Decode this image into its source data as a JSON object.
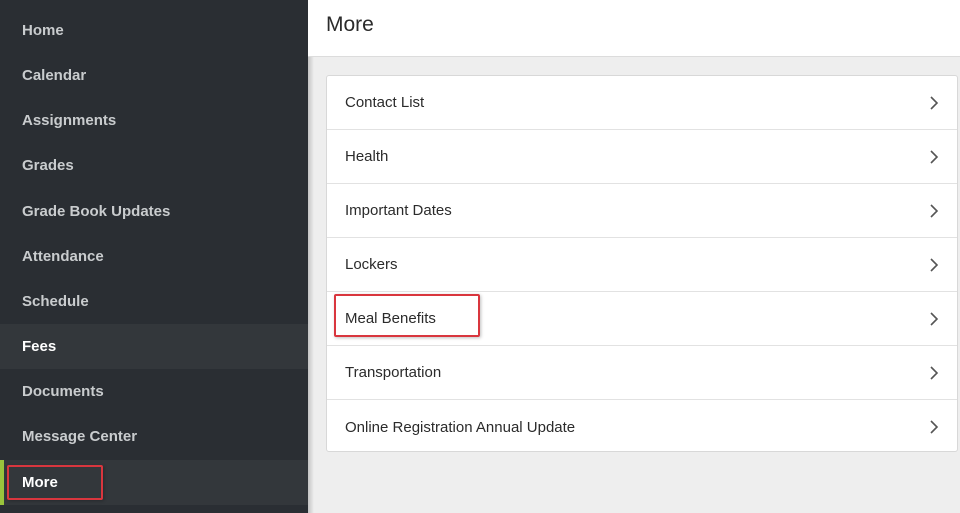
{
  "sidebar": {
    "items": [
      {
        "label": "Home"
      },
      {
        "label": "Calendar"
      },
      {
        "label": "Assignments"
      },
      {
        "label": "Grades"
      },
      {
        "label": "Grade Book Updates"
      },
      {
        "label": "Attendance"
      },
      {
        "label": "Schedule"
      },
      {
        "label": "Fees"
      },
      {
        "label": "Documents"
      },
      {
        "label": "Message Center"
      },
      {
        "label": "More"
      }
    ],
    "hovered_item": "Fees",
    "active_item": "More"
  },
  "header": {
    "title": "More"
  },
  "main": {
    "list": [
      {
        "label": "Contact List",
        "icon": "chevron-right-icon"
      },
      {
        "label": "Health",
        "icon": "chevron-right-icon"
      },
      {
        "label": "Important Dates",
        "icon": "chevron-right-icon"
      },
      {
        "label": "Lockers",
        "icon": "chevron-right-icon"
      },
      {
        "label": "Meal Benefits",
        "icon": "chevron-right-icon"
      },
      {
        "label": "Transportation",
        "icon": "chevron-right-icon"
      },
      {
        "label": "Online Registration Annual Update",
        "icon": "chevron-right-icon"
      }
    ]
  },
  "colors": {
    "sidebar_bg": "#2a2e33",
    "sidebar_text": "#c9ccce",
    "active_bar": "#9ac33c",
    "highlight_border": "#d9363e",
    "content_bg": "#eeeeee"
  }
}
